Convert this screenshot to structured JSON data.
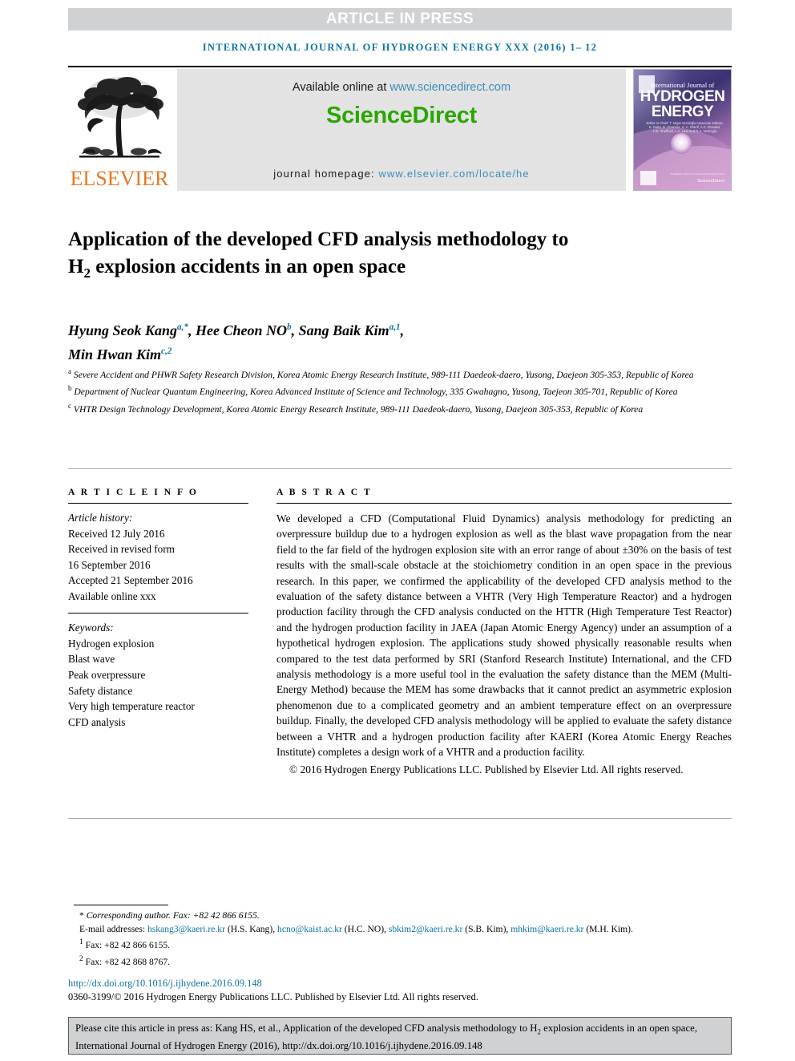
{
  "banner": {
    "label": "ARTICLE IN PRESS",
    "bg_color": "#cfd1d3",
    "text_color": "#ffffff"
  },
  "running_head": {
    "text": "INTERNATIONAL JOURNAL OF HYDROGEN ENERGY XXX (2016) 1– 12",
    "color": "#0c74a4"
  },
  "masthead": {
    "publisher": "ELSEVIER",
    "publisher_color": "#e87722",
    "available_prefix": "Available online at ",
    "available_url": "www.sciencedirect.com",
    "sciencedirect_logo": "ScienceDirect",
    "sciencedirect_color": "#2ba600",
    "homepage_prefix": "journal homepage: ",
    "homepage_url": "www.elsevier.com/locate/he",
    "link_color": "#3a8dbd",
    "cover": {
      "line1": "International Journal of",
      "line2": "HYDROGEN",
      "line3": "ENERGY",
      "editors": "Editor-in-Chief: T. Nejat Veziroğlu   Associate Editors: S. Dutta, D. Chandra, S. A. Sherif, A.C. Rosales, J.W. Sheffield, L.A. Laat and D.A. Veziroglu",
      "footer_brand": "ScienceDirect",
      "footer_tag": "Available online at www.sciencedirect.com"
    }
  },
  "title": {
    "part1": "Application of the developed CFD analysis methodology to H",
    "sub": "2",
    "part2": " explosion accidents in an open space"
  },
  "authors": {
    "line1": [
      {
        "name": "Hyung Seok Kang",
        "sup": "a,*"
      },
      {
        "name": "Hee Cheon NO",
        "sup": "b"
      },
      {
        "name": "Sang Baik Kim",
        "sup": "a,1"
      }
    ],
    "line2": [
      {
        "name": "Min Hwan Kim",
        "sup": "c,2"
      }
    ],
    "sup_color": "#0c74a4"
  },
  "affiliations": [
    {
      "mark": "a",
      "text": "Severe Accident and PHWR Safety Research Division, Korea Atomic Energy Research Institute, 989-111 Daedeok-daero, Yusong, Daejeon 305-353, Republic of Korea"
    },
    {
      "mark": "b",
      "text": "Department of Nuclear Quantum Engineering, Korea Advanced Institute of Science and Technology, 335 Gwahagno, Yusong, Taejeon 305-701, Republic of Korea"
    },
    {
      "mark": "c",
      "text": "VHTR Design Technology Development, Korea Atomic Energy Research Institute, 989-111 Daedeok-daero, Yusong, Daejeon 305-353, Republic of Korea"
    }
  ],
  "article_info": {
    "heading": "A R T I C L E  I N F O",
    "history_label": "Article history:",
    "history": [
      "Received 12 July 2016",
      "Received in revised form",
      "16 September 2016",
      "Accepted 21 September 2016",
      "Available online xxx"
    ],
    "keywords_label": "Keywords:",
    "keywords": [
      "Hydrogen explosion",
      "Blast wave",
      "Peak overpressure",
      "Safety distance",
      "Very high temperature reactor",
      "CFD analysis"
    ]
  },
  "abstract": {
    "heading": "A B S T R A C T",
    "body": "We developed a CFD (Computational Fluid Dynamics) analysis methodology for predicting an overpressure buildup due to a hydrogen explosion as well as the blast wave propagation from the near field to the far field of the hydrogen explosion site with an error range of about ±30% on the basis of test results with the small-scale obstacle at the stoichiometry condition in an open space in the previous research. In this paper, we confirmed the applicability of the developed CFD analysis method to the evaluation of the safety distance between a VHTR (Very High Temperature Reactor) and a hydrogen production facility through the CFD analysis conducted on the HTTR (High Temperature Test Reactor) and the hydrogen production facility in JAEA (Japan Atomic Energy Agency) under an assumption of a hypothetical hydrogen explosion. The applications study showed physically reasonable results when compared to the test data performed by SRI (Stanford Research Institute) International, and the CFD analysis methodology is a more useful tool in the evaluation the safety distance than the MEM (Multi-Energy Method) because the MEM has some drawbacks that it cannot predict an asymmetric explosion phenomenon due to a complicated geometry and an ambient temperature effect on an overpressure buildup. Finally, the developed CFD analysis methodology will be applied to evaluate the safety distance between a VHTR and a hydrogen production facility after KAERI (Korea Atomic Energy Reaches Institute) completes a design work of a VHTR and a production facility.",
    "copyright": "© 2016 Hydrogen Energy Publications LLC. Published by Elsevier Ltd. All rights reserved."
  },
  "footnotes": {
    "corresponding": "Corresponding author. Fax: +82 42 866 6155.",
    "email_label": "E-mail addresses: ",
    "emails": [
      {
        "address": "hskang3@kaeri.re.kr",
        "owner": "(H.S. Kang), "
      },
      {
        "address": "hcno@kaist.ac.kr",
        "owner": "(H.C. NO), "
      },
      {
        "address": "sbkim2@kaeri.re.kr",
        "owner": "(S.B. Kim), "
      },
      {
        "address": "mhkim@kaeri.re.kr",
        "owner": "(M.H. Kim)."
      }
    ],
    "note1_mark": "1",
    "note1": "Fax: +82 42 866 6155.",
    "note2_mark": "2",
    "note2": "Fax: +82 42 868 8767.",
    "doi": "http://dx.doi.org/10.1016/j.ijhydene.2016.09.148",
    "issn": "0360-3199/© 2016 Hydrogen Energy Publications LLC. Published by Elsevier Ltd. All rights reserved.",
    "link_color": "#0c74a4"
  },
  "cite_box": {
    "part1": "Please cite this article in press as: Kang HS, et al., Application of the developed CFD analysis methodology to H",
    "sub": "2",
    "part2": " explosion accidents in an open space, International Journal of Hydrogen Energy (2016), http://dx.doi.org/10.1016/j.ijhydene.2016.09.148",
    "bg_color": "#cfd1d3"
  }
}
